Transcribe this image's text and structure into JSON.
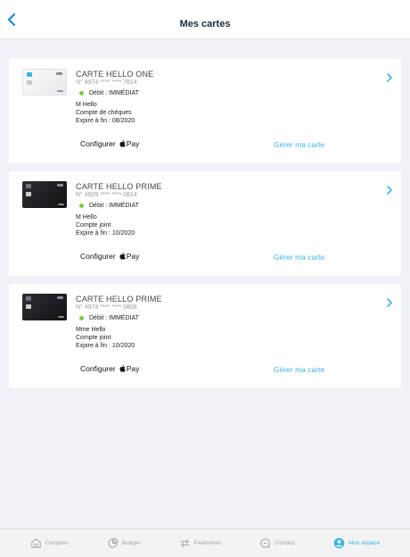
{
  "header": {
    "title": "Mes cartes"
  },
  "colors": {
    "accent": "#3fb4de",
    "status_green": "#7ac943",
    "nav_inactive": "#a3a5a9"
  },
  "cards": [
    {
      "name": "CARTE HELLO ONE",
      "number": "N° 4974 **** **** 7814",
      "debit": "Débit : IMMÉDIAT",
      "holder": "M Hello",
      "account": "Compte de chèques",
      "expiry": "Expire à fin : 08/2020",
      "card_color": "white",
      "card_logo_text": "VISA",
      "applepay_label": "Configurer",
      "applepay_brand": "Pay",
      "manage_label": "Gérer ma carte"
    },
    {
      "name": "CARTE HELLO PRIME",
      "number": "N° 4609 **** **** 0814",
      "debit": "Débit : IMMÉDIAT",
      "holder": "M Hello",
      "account": "Compte joint",
      "expiry": "Expire à fin : 10/2020",
      "card_color": "black",
      "card_logo_text": "VISA",
      "applepay_label": "Configurer",
      "applepay_brand": "Pay",
      "manage_label": "Gérer ma carte"
    },
    {
      "name": "CARTE HELLO PRIME",
      "number": "N° 4974 **** **** 0809",
      "debit": "Débit : IMMÉDIAT",
      "holder": "Mme Hello",
      "account": "Compte joint",
      "expiry": "Expire à fin : 10/2020",
      "card_color": "black",
      "card_logo_text": "VISA",
      "applepay_label": "Configurer",
      "applepay_brand": "Pay",
      "manage_label": "Gérer ma carte"
    }
  ],
  "tabbar": {
    "items": [
      {
        "label": "Comptes",
        "icon": "bank-icon",
        "active": false
      },
      {
        "label": "Budget",
        "icon": "pie-chart-icon",
        "active": false
      },
      {
        "label": "Paiements",
        "icon": "transfer-icon",
        "active": false
      },
      {
        "label": "Contact",
        "icon": "chat-icon",
        "active": false
      },
      {
        "label": "Mon espace",
        "icon": "user-icon",
        "active": true
      }
    ]
  }
}
